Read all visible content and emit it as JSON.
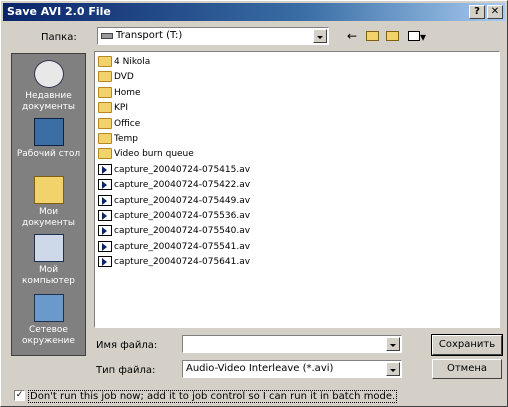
{
  "window": {
    "title": "Save AVI 2.0 File",
    "help_label": "?",
    "close_label": "✕"
  },
  "toolbar": {
    "folder_label": "Папка:",
    "folder_value": "Transport (T:)",
    "back_icon": "←",
    "up_icon": "up-folder-icon",
    "new_folder_icon": "new-folder-icon",
    "views_icon": "views-icon"
  },
  "places": [
    {
      "label": "Недавние документы",
      "icon": "recent-docs-icon"
    },
    {
      "label": "Рабочий стол",
      "icon": "desktop-icon"
    },
    {
      "label": "Мои документы",
      "icon": "my-documents-icon"
    },
    {
      "label": "Мой компьютер",
      "icon": "my-computer-icon"
    },
    {
      "label": "Сетевое окружение",
      "icon": "network-icon"
    }
  ],
  "files": [
    {
      "name": "4 Nikola",
      "type": "folder"
    },
    {
      "name": "DVD",
      "type": "folder"
    },
    {
      "name": "Home",
      "type": "folder"
    },
    {
      "name": "KPI",
      "type": "folder"
    },
    {
      "name": "Office",
      "type": "folder"
    },
    {
      "name": "Temp",
      "type": "folder"
    },
    {
      "name": "Video burn queue",
      "type": "folder"
    },
    {
      "name": "capture_20040724-075415.av",
      "type": "avi"
    },
    {
      "name": "capture_20040724-075422.av",
      "type": "avi"
    },
    {
      "name": "capture_20040724-075449.av",
      "type": "avi"
    },
    {
      "name": "capture_20040724-075536.av",
      "type": "avi"
    },
    {
      "name": "capture_20040724-075540.av",
      "type": "avi"
    },
    {
      "name": "capture_20040724-075541.av",
      "type": "avi"
    },
    {
      "name": "capture_20040724-075641.av",
      "type": "avi"
    }
  ],
  "form": {
    "filename_label": "Имя файла:",
    "filename_value": "",
    "filetype_label": "Тип файла:",
    "filetype_value": "Audio-Video Interleave (*.avi)",
    "save_label": "Сохранить",
    "cancel_label": "Отмена"
  },
  "checkbox": {
    "label": "Don't run this job now; add it to job control so I can run it in batch mode.",
    "checked": true,
    "mark": "✓"
  }
}
